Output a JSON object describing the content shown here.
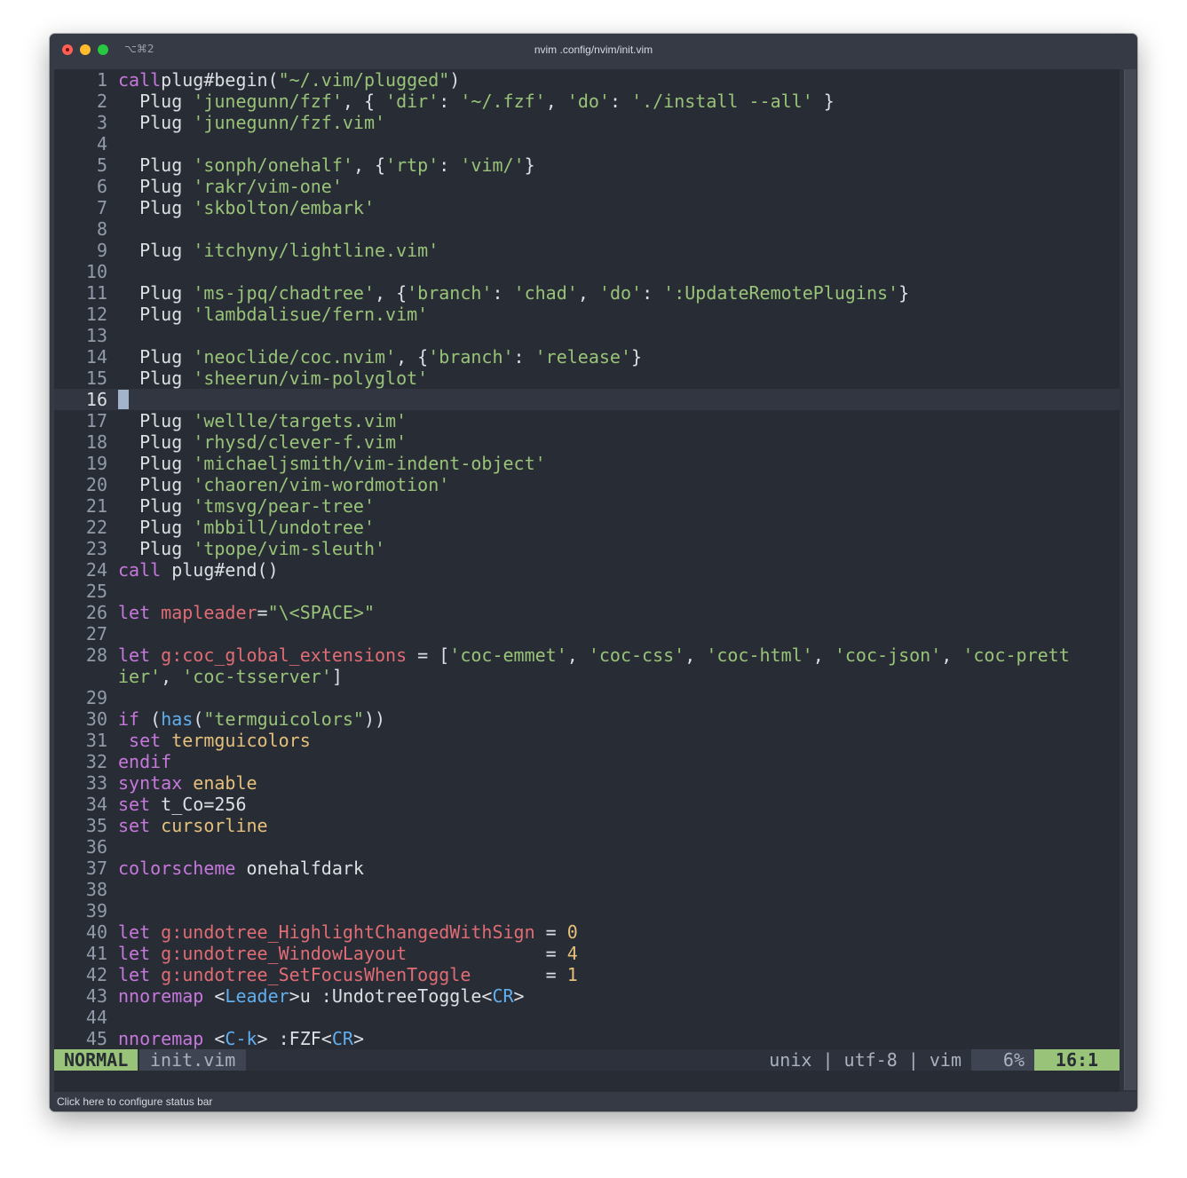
{
  "window": {
    "shortcut": "⌥⌘2",
    "title": "nvim .config/nvim/init.vim",
    "bottom_hint": "Click here to configure status bar"
  },
  "colors": {
    "background": "#282c34",
    "cursorline": "#313640",
    "keyword": "#c678dd",
    "string": "#98c379",
    "variable": "#e06c75",
    "number": "#e5c07b",
    "function": "#61afef",
    "mode_bg": "#98c379"
  },
  "editor": {
    "cursor_line": 16,
    "lines": [
      {
        "n": "1",
        "tokens": [
          [
            "kw",
            "call"
          ],
          [
            "",
            "plug#begin("
          ],
          [
            "str",
            "\"~/.vim/plugged\""
          ],
          [
            "",
            ")"
          ]
        ]
      },
      {
        "n": "2",
        "tokens": [
          [
            "",
            "  Plug "
          ],
          [
            "str",
            "'junegunn/fzf'"
          ],
          [
            "",
            ", { "
          ],
          [
            "str",
            "'dir'"
          ],
          [
            "",
            ": "
          ],
          [
            "str",
            "'~/.fzf'"
          ],
          [
            "",
            ", "
          ],
          [
            "str",
            "'do'"
          ],
          [
            "",
            ": "
          ],
          [
            "str",
            "'./install --all'"
          ],
          [
            "",
            " }"
          ]
        ]
      },
      {
        "n": "3",
        "tokens": [
          [
            "",
            "  Plug "
          ],
          [
            "str",
            "'junegunn/fzf.vim'"
          ]
        ]
      },
      {
        "n": "4",
        "tokens": []
      },
      {
        "n": "5",
        "tokens": [
          [
            "",
            "  Plug "
          ],
          [
            "str",
            "'sonph/onehalf'"
          ],
          [
            "",
            ", {"
          ],
          [
            "str",
            "'rtp'"
          ],
          [
            "",
            ": "
          ],
          [
            "str",
            "'vim/'"
          ],
          [
            "",
            "}"
          ]
        ]
      },
      {
        "n": "6",
        "tokens": [
          [
            "",
            "  Plug "
          ],
          [
            "str",
            "'rakr/vim-one'"
          ]
        ]
      },
      {
        "n": "7",
        "tokens": [
          [
            "",
            "  Plug "
          ],
          [
            "str",
            "'skbolton/embark'"
          ]
        ]
      },
      {
        "n": "8",
        "tokens": []
      },
      {
        "n": "9",
        "tokens": [
          [
            "",
            "  Plug "
          ],
          [
            "str",
            "'itchyny/lightline.vim'"
          ]
        ]
      },
      {
        "n": "10",
        "tokens": []
      },
      {
        "n": "11",
        "tokens": [
          [
            "",
            "  Plug "
          ],
          [
            "str",
            "'ms-jpq/chadtree'"
          ],
          [
            "",
            ", {"
          ],
          [
            "str",
            "'branch'"
          ],
          [
            "",
            ": "
          ],
          [
            "str",
            "'chad'"
          ],
          [
            "",
            ", "
          ],
          [
            "str",
            "'do'"
          ],
          [
            "",
            ": "
          ],
          [
            "str",
            "':UpdateRemotePlugins'"
          ],
          [
            "",
            "}"
          ]
        ]
      },
      {
        "n": "12",
        "tokens": [
          [
            "",
            "  Plug "
          ],
          [
            "str",
            "'lambdalisue/fern.vim'"
          ]
        ]
      },
      {
        "n": "13",
        "tokens": []
      },
      {
        "n": "14",
        "tokens": [
          [
            "",
            "  Plug "
          ],
          [
            "str",
            "'neoclide/coc.nvim'"
          ],
          [
            "",
            ", {"
          ],
          [
            "str",
            "'branch'"
          ],
          [
            "",
            ": "
          ],
          [
            "str",
            "'release'"
          ],
          [
            "",
            "}"
          ]
        ]
      },
      {
        "n": "15",
        "tokens": [
          [
            "",
            "  Plug "
          ],
          [
            "str",
            "'sheerun/vim-polyglot'"
          ]
        ]
      },
      {
        "n": "16",
        "tokens": []
      },
      {
        "n": "17",
        "tokens": [
          [
            "",
            "  Plug "
          ],
          [
            "str",
            "'wellle/targets.vim'"
          ]
        ]
      },
      {
        "n": "18",
        "tokens": [
          [
            "",
            "  Plug "
          ],
          [
            "str",
            "'rhysd/clever-f.vim'"
          ]
        ]
      },
      {
        "n": "19",
        "tokens": [
          [
            "",
            "  Plug "
          ],
          [
            "str",
            "'michaeljsmith/vim-indent-object'"
          ]
        ]
      },
      {
        "n": "20",
        "tokens": [
          [
            "",
            "  Plug "
          ],
          [
            "str",
            "'chaoren/vim-wordmotion'"
          ]
        ]
      },
      {
        "n": "21",
        "tokens": [
          [
            "",
            "  Plug "
          ],
          [
            "str",
            "'tmsvg/pear-tree'"
          ]
        ]
      },
      {
        "n": "22",
        "tokens": [
          [
            "",
            "  Plug "
          ],
          [
            "str",
            "'mbbill/undotree'"
          ]
        ]
      },
      {
        "n": "23",
        "tokens": [
          [
            "",
            "  Plug "
          ],
          [
            "str",
            "'tpope/vim-sleuth'"
          ]
        ]
      },
      {
        "n": "24",
        "tokens": [
          [
            "kw",
            "call"
          ],
          [
            "",
            " plug#end()"
          ]
        ]
      },
      {
        "n": "25",
        "tokens": []
      },
      {
        "n": "26",
        "tokens": [
          [
            "kw",
            "let"
          ],
          [
            "",
            " "
          ],
          [
            "var",
            "mapleader"
          ],
          [
            "",
            "="
          ],
          [
            "str",
            "\"\\<SPACE>\""
          ]
        ]
      },
      {
        "n": "27",
        "tokens": []
      },
      {
        "n": "28",
        "wrap": true,
        "tokens": [
          [
            "kw",
            "let"
          ],
          [
            "",
            " "
          ],
          [
            "var",
            "g:coc_global_extensions"
          ],
          [
            "",
            " = ["
          ],
          [
            "str",
            "'coc-emmet'"
          ],
          [
            "",
            ", "
          ],
          [
            "str",
            "'coc-css'"
          ],
          [
            "",
            ", "
          ],
          [
            "str",
            "'coc-html'"
          ],
          [
            "",
            ", "
          ],
          [
            "str",
            "'coc-json'"
          ],
          [
            "",
            ", "
          ],
          [
            "str",
            "'coc-prettier'"
          ],
          [
            "",
            ", "
          ],
          [
            "str",
            "'coc-tsserver'"
          ],
          [
            "",
            "]"
          ]
        ]
      },
      {
        "n": "29",
        "tokens": []
      },
      {
        "n": "30",
        "tokens": [
          [
            "kw",
            "if"
          ],
          [
            "",
            " ("
          ],
          [
            "fn",
            "has"
          ],
          [
            "",
            "("
          ],
          [
            "str",
            "\"termguicolors\""
          ],
          [
            "",
            "))"
          ]
        ]
      },
      {
        "n": "31",
        "tokens": [
          [
            "",
            " "
          ],
          [
            "kw",
            "set"
          ],
          [
            "",
            " "
          ],
          [
            "opt",
            "termguicolors"
          ]
        ]
      },
      {
        "n": "32",
        "tokens": [
          [
            "kw",
            "endif"
          ]
        ]
      },
      {
        "n": "33",
        "tokens": [
          [
            "kw",
            "syntax"
          ],
          [
            "",
            " "
          ],
          [
            "opt",
            "enable"
          ]
        ]
      },
      {
        "n": "34",
        "tokens": [
          [
            "kw",
            "set"
          ],
          [
            "",
            " t_Co=256"
          ]
        ]
      },
      {
        "n": "35",
        "tokens": [
          [
            "kw",
            "set"
          ],
          [
            "",
            " "
          ],
          [
            "opt",
            "cursorline"
          ]
        ]
      },
      {
        "n": "36",
        "tokens": []
      },
      {
        "n": "37",
        "tokens": [
          [
            "kw",
            "colorscheme"
          ],
          [
            "",
            " onehalfdark"
          ]
        ]
      },
      {
        "n": "38",
        "tokens": []
      },
      {
        "n": "39",
        "tokens": []
      },
      {
        "n": "40",
        "tokens": [
          [
            "kw",
            "let"
          ],
          [
            "",
            " "
          ],
          [
            "var",
            "g:undotree_HighlightChangedWithSign"
          ],
          [
            "",
            " = "
          ],
          [
            "num",
            "0"
          ]
        ]
      },
      {
        "n": "41",
        "tokens": [
          [
            "kw",
            "let"
          ],
          [
            "",
            " "
          ],
          [
            "var",
            "g:undotree_WindowLayout"
          ],
          [
            "",
            "             = "
          ],
          [
            "num",
            "4"
          ]
        ]
      },
      {
        "n": "42",
        "tokens": [
          [
            "kw",
            "let"
          ],
          [
            "",
            " "
          ],
          [
            "var",
            "g:undotree_SetFocusWhenToggle"
          ],
          [
            "",
            "       = "
          ],
          [
            "num",
            "1"
          ]
        ]
      },
      {
        "n": "43",
        "tokens": [
          [
            "kw",
            "nnoremap"
          ],
          [
            "",
            " <"
          ],
          [
            "fn",
            "Leader"
          ],
          [
            "",
            ">u :UndotreeToggle<"
          ],
          [
            "fn",
            "CR"
          ],
          [
            "",
            ">"
          ]
        ]
      },
      {
        "n": "44",
        "tokens": []
      },
      {
        "n": "45",
        "tokens": [
          [
            "kw",
            "nnoremap"
          ],
          [
            "",
            " <"
          ],
          [
            "fn",
            "C-k"
          ],
          [
            "",
            "> :FZF<"
          ],
          [
            "fn",
            "CR"
          ],
          [
            "",
            ">"
          ]
        ]
      }
    ]
  },
  "statusline": {
    "mode": "NORMAL",
    "filename": "init.vim",
    "fileinfo": "unix | utf-8 | vim",
    "percent": "6%",
    "position": "16:1"
  }
}
